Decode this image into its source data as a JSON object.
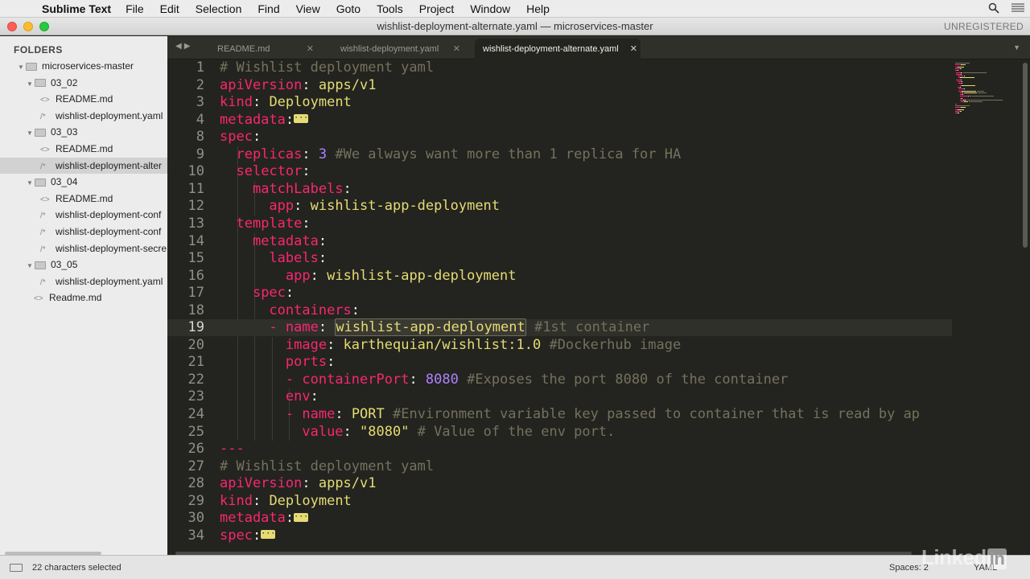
{
  "menubar": {
    "app": "Sublime Text",
    "items": [
      "File",
      "Edit",
      "Selection",
      "Find",
      "View",
      "Goto",
      "Tools",
      "Project",
      "Window",
      "Help"
    ]
  },
  "window": {
    "title": "wishlist-deployment-alternate.yaml — microservices-master",
    "license": "UNREGISTERED"
  },
  "sidebar": {
    "header": "FOLDERS",
    "items": [
      {
        "label": "microservices-master",
        "kind": "folder",
        "depth": 0,
        "expanded": true
      },
      {
        "label": "03_02",
        "kind": "folder",
        "depth": 1,
        "expanded": true
      },
      {
        "label": "README.md",
        "kind": "file-md",
        "depth": 2
      },
      {
        "label": "wishlist-deployment.yaml",
        "kind": "file-yaml",
        "depth": 2
      },
      {
        "label": "03_03",
        "kind": "folder",
        "depth": 1,
        "expanded": true
      },
      {
        "label": "README.md",
        "kind": "file-md",
        "depth": 2
      },
      {
        "label": "wishlist-deployment-alter",
        "kind": "file-yaml",
        "depth": 2,
        "selected": true
      },
      {
        "label": "03_04",
        "kind": "folder",
        "depth": 1,
        "expanded": true
      },
      {
        "label": "README.md",
        "kind": "file-md",
        "depth": 2
      },
      {
        "label": "wishlist-deployment-conf",
        "kind": "file-yaml",
        "depth": 2
      },
      {
        "label": "wishlist-deployment-conf",
        "kind": "file-yaml",
        "depth": 2
      },
      {
        "label": "wishlist-deployment-secre",
        "kind": "file-yaml",
        "depth": 2
      },
      {
        "label": "03_05",
        "kind": "folder",
        "depth": 1,
        "expanded": true
      },
      {
        "label": "wishlist-deployment.yaml",
        "kind": "file-yaml",
        "depth": 2
      },
      {
        "label": "Readme.md",
        "kind": "file-md",
        "depth": 1
      }
    ]
  },
  "tabs": [
    {
      "label": "README.md",
      "active": false
    },
    {
      "label": "wishlist-deployment.yaml",
      "active": false
    },
    {
      "label": "wishlist-deployment-alternate.yaml",
      "active": true
    }
  ],
  "editor": {
    "lines": [
      {
        "n": "1",
        "tokens": [
          [
            "c",
            "# Wishlist deployment yaml"
          ]
        ]
      },
      {
        "n": "2",
        "tokens": [
          [
            "k",
            "apiVersion"
          ],
          [
            "w",
            ": "
          ],
          [
            "s",
            "apps/v1"
          ]
        ]
      },
      {
        "n": "3",
        "tokens": [
          [
            "k",
            "kind"
          ],
          [
            "w",
            ": "
          ],
          [
            "s",
            "Deployment"
          ]
        ]
      },
      {
        "n": "4",
        "tokens": [
          [
            "k",
            "metadata"
          ],
          [
            "w",
            ":"
          ],
          [
            "fold",
            ""
          ]
        ]
      },
      {
        "n": "8",
        "tokens": [
          [
            "k",
            "spec"
          ],
          [
            "w",
            ":"
          ]
        ]
      },
      {
        "n": "9",
        "tokens": [
          [
            "w",
            "  "
          ],
          [
            "k",
            "replicas"
          ],
          [
            "w",
            ": "
          ],
          [
            "n",
            "3"
          ],
          [
            "w",
            " "
          ],
          [
            "c",
            "#We always want more than 1 replica for HA"
          ]
        ]
      },
      {
        "n": "10",
        "tokens": [
          [
            "w",
            "  "
          ],
          [
            "k",
            "selector"
          ],
          [
            "w",
            ":"
          ]
        ]
      },
      {
        "n": "11",
        "tokens": [
          [
            "w",
            "    "
          ],
          [
            "k",
            "matchLabels"
          ],
          [
            "w",
            ":"
          ]
        ]
      },
      {
        "n": "12",
        "tokens": [
          [
            "w",
            "      "
          ],
          [
            "k",
            "app"
          ],
          [
            "w",
            ": "
          ],
          [
            "s",
            "wishlist-app-deployment"
          ]
        ]
      },
      {
        "n": "13",
        "tokens": [
          [
            "w",
            "  "
          ],
          [
            "k",
            "template"
          ],
          [
            "w",
            ":"
          ]
        ]
      },
      {
        "n": "14",
        "tokens": [
          [
            "w",
            "    "
          ],
          [
            "k",
            "metadata"
          ],
          [
            "w",
            ":"
          ]
        ]
      },
      {
        "n": "15",
        "tokens": [
          [
            "w",
            "      "
          ],
          [
            "k",
            "labels"
          ],
          [
            "w",
            ":"
          ]
        ]
      },
      {
        "n": "16",
        "tokens": [
          [
            "w",
            "        "
          ],
          [
            "k",
            "app"
          ],
          [
            "w",
            ": "
          ],
          [
            "s",
            "wishlist-app-deployment"
          ]
        ]
      },
      {
        "n": "17",
        "tokens": [
          [
            "w",
            "    "
          ],
          [
            "k",
            "spec"
          ],
          [
            "w",
            ":"
          ]
        ]
      },
      {
        "n": "18",
        "tokens": [
          [
            "w",
            "      "
          ],
          [
            "k",
            "containers"
          ],
          [
            "w",
            ":"
          ]
        ]
      },
      {
        "n": "19",
        "current": true,
        "tokens": [
          [
            "w",
            "      "
          ],
          [
            "k",
            "- "
          ],
          [
            "k",
            "name"
          ],
          [
            "w",
            ": "
          ],
          [
            "sel",
            "wishlist-app-deployment"
          ],
          [
            "w",
            " "
          ],
          [
            "c",
            "#1st container"
          ]
        ]
      },
      {
        "n": "20",
        "tokens": [
          [
            "w",
            "        "
          ],
          [
            "k",
            "image"
          ],
          [
            "w",
            ": "
          ],
          [
            "s",
            "karthequian/wishlist:1.0"
          ],
          [
            "w",
            " "
          ],
          [
            "c",
            "#Dockerhub image"
          ]
        ]
      },
      {
        "n": "21",
        "tokens": [
          [
            "w",
            "        "
          ],
          [
            "k",
            "ports"
          ],
          [
            "w",
            ":"
          ]
        ]
      },
      {
        "n": "22",
        "tokens": [
          [
            "w",
            "        "
          ],
          [
            "k",
            "- "
          ],
          [
            "k",
            "containerPort"
          ],
          [
            "w",
            ": "
          ],
          [
            "n",
            "8080"
          ],
          [
            "w",
            " "
          ],
          [
            "c",
            "#Exposes the port 8080 of the container"
          ]
        ]
      },
      {
        "n": "23",
        "tokens": [
          [
            "w",
            "        "
          ],
          [
            "k",
            "env"
          ],
          [
            "w",
            ":"
          ]
        ]
      },
      {
        "n": "24",
        "tokens": [
          [
            "w",
            "        "
          ],
          [
            "k",
            "- "
          ],
          [
            "k",
            "name"
          ],
          [
            "w",
            ": "
          ],
          [
            "s",
            "PORT"
          ],
          [
            "w",
            " "
          ],
          [
            "c",
            "#Environment variable key passed to container that is read by ap"
          ]
        ]
      },
      {
        "n": "25",
        "tokens": [
          [
            "w",
            "          "
          ],
          [
            "k",
            "value"
          ],
          [
            "w",
            ": "
          ],
          [
            "s",
            "\"8080\""
          ],
          [
            "w",
            " "
          ],
          [
            "c",
            "# Value of the env port."
          ]
        ]
      },
      {
        "n": "26",
        "tokens": [
          [
            "k",
            "---"
          ]
        ]
      },
      {
        "n": "27",
        "tokens": [
          [
            "c",
            "# Wishlist deployment yaml"
          ]
        ]
      },
      {
        "n": "28",
        "tokens": [
          [
            "k",
            "apiVersion"
          ],
          [
            "w",
            ": "
          ],
          [
            "s",
            "apps/v1"
          ]
        ]
      },
      {
        "n": "29",
        "tokens": [
          [
            "k",
            "kind"
          ],
          [
            "w",
            ": "
          ],
          [
            "s",
            "Deployment"
          ]
        ]
      },
      {
        "n": "30",
        "tokens": [
          [
            "k",
            "metadata"
          ],
          [
            "w",
            ":"
          ],
          [
            "fold",
            ""
          ]
        ]
      },
      {
        "n": "34",
        "tokens": [
          [
            "k",
            "spec"
          ],
          [
            "w",
            ":"
          ],
          [
            "fold",
            ""
          ]
        ]
      }
    ]
  },
  "status": {
    "message": "22 characters selected",
    "indent": "Spaces: 2",
    "syntax": "YAML"
  },
  "watermark": {
    "text": "Linked",
    "badge": "in"
  },
  "colors": {
    "keyword": "#f92672",
    "string": "#e6db74",
    "number": "#ae81ff",
    "comment": "#75715e",
    "background": "#23241f"
  }
}
